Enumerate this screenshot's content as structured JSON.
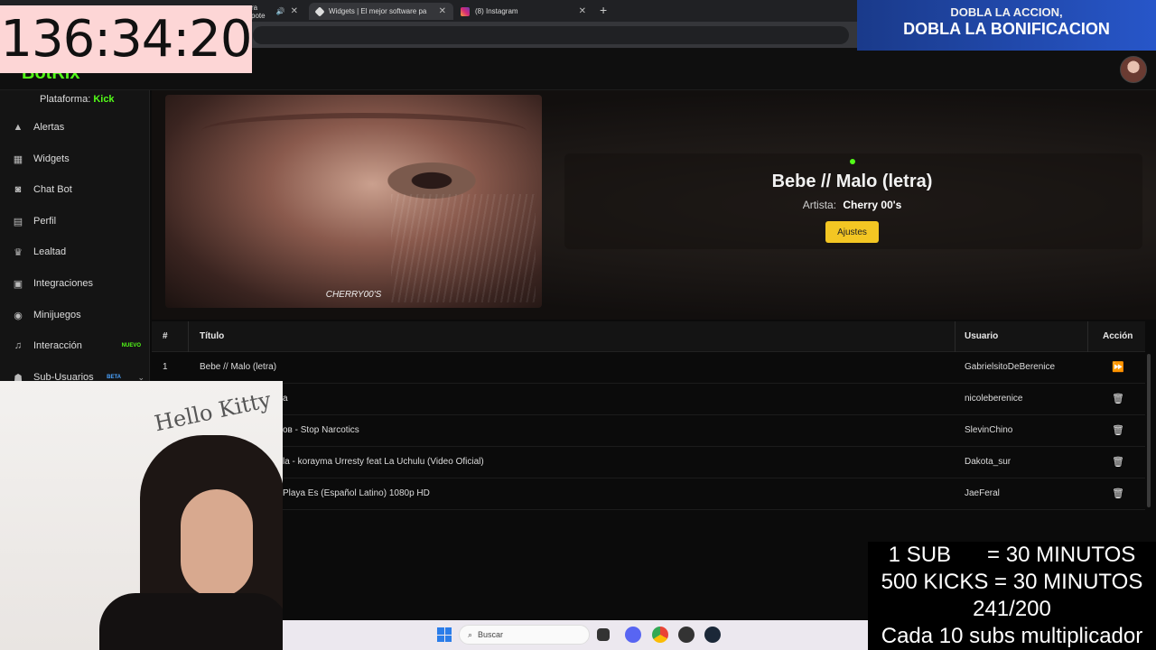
{
  "browser": {
    "tabs": [
      {
        "label": "ra pote",
        "active": false
      },
      {
        "label": "Widgets | El mejor software pa",
        "active": true
      },
      {
        "label": "(8) Instagram",
        "active": false
      }
    ],
    "new_tab": "+",
    "close": "✕"
  },
  "app": {
    "logo": "BotRix",
    "platform_label": "Plataforma:",
    "platform_value": "Kick"
  },
  "sidebar": {
    "items": [
      {
        "label": "Alertas",
        "icon": "warning-icon"
      },
      {
        "label": "Widgets",
        "icon": "grid-icon"
      },
      {
        "label": "Chat Bot",
        "icon": "robot-icon"
      },
      {
        "label": "Perfil",
        "icon": "id-card-icon"
      },
      {
        "label": "Lealtad",
        "icon": "trophy-icon"
      },
      {
        "label": "Integraciones",
        "icon": "plug-icon"
      },
      {
        "label": "Minijuegos",
        "icon": "gamepad-icon"
      },
      {
        "label": "Interacción",
        "icon": "music-icon",
        "badge": "NUEVO"
      },
      {
        "label": "Sub-Usuarios",
        "icon": "users-icon",
        "badge": "BETA"
      }
    ]
  },
  "now_playing": {
    "cover_caption": "CHERRY00'S",
    "title": "Bebe // Malo (letra)",
    "artist_label": "Artista:",
    "artist": "Cherry 00's",
    "settings_button": "Ajustes"
  },
  "queue": {
    "headers": {
      "num": "#",
      "title": "Título",
      "user": "Usuario",
      "action": "Acción"
    },
    "rows": [
      {
        "num": "1",
        "title": "Bebe // Malo (letra)",
        "user": "GabrielsitoDeBerenice",
        "action": "skip"
      },
      {
        "num": "",
        "title": "a",
        "user": "nicoleberenice",
        "action": "delete"
      },
      {
        "num": "",
        "title": "ов - Stop Narcotics",
        "user": "SlevinChino",
        "action": "delete"
      },
      {
        "num": "",
        "title": "la - korayma Urresty feat La Uchulu (Video Oficial)",
        "user": "Dakota_sur",
        "action": "delete"
      },
      {
        "num": "",
        "title": "Playa Es (Español Latino) 1080p HD",
        "user": "JaeFeral",
        "action": "delete"
      }
    ]
  },
  "overlay": {
    "timer": "136:34:20",
    "promo_line1": "DOBLA LA ACCION,",
    "promo_line2": "DOBLA LA BONIFICACION",
    "webcam_sticker": "Hello Kitty",
    "goal_lines": [
      "1 SUB      = 30 MINUTOS",
      "500 KICKS = 30 MINUTOS",
      "241/200",
      "Cada 10 subs multiplicador"
    ]
  },
  "taskbar": {
    "search_placeholder": "Buscar"
  },
  "colors": {
    "accent": "#53fc18",
    "button": "#f3c623",
    "timer_bg": "#fdd6d6"
  }
}
